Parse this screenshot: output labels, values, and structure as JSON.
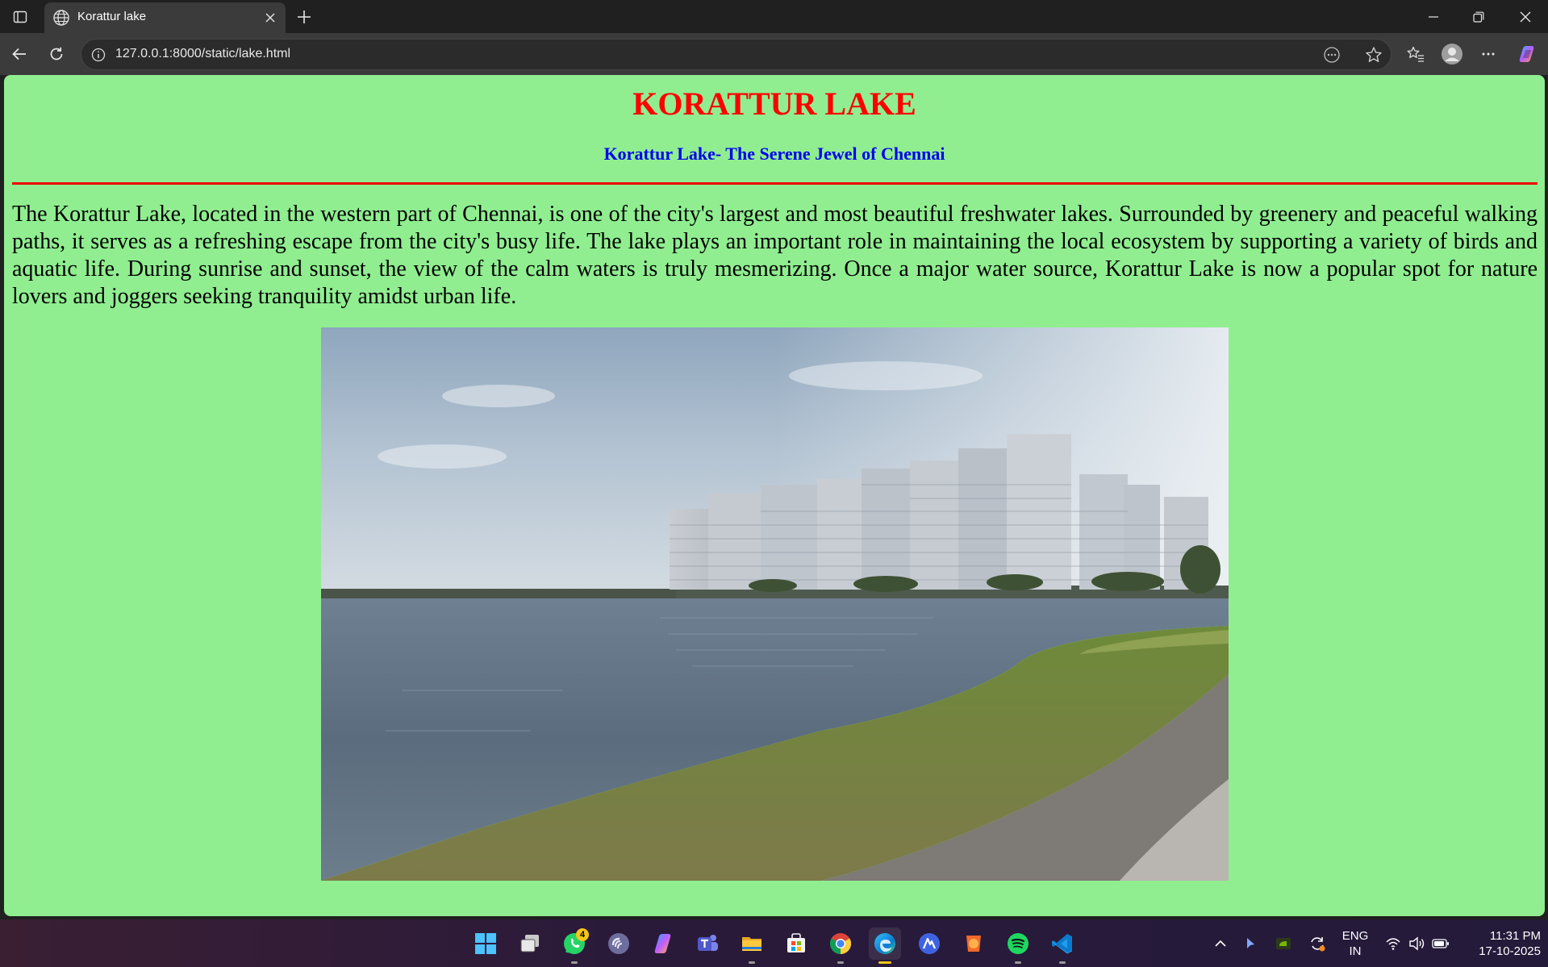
{
  "browser": {
    "tab_title": "Korattur lake",
    "url": "127.0.0.1:8000/static/lake.html"
  },
  "page": {
    "heading": "KORATTUR LAKE",
    "subheading": "Korattur Lake- The Serene Jewel of Chennai",
    "paragraph": "The Korattur Lake, located in the western part of Chennai, is one of the city's largest and most beautiful freshwater lakes. Surrounded by greenery and peaceful walking paths, it serves as a refreshing escape from the city's busy life. The lake plays an important role in maintaining the local ecosystem by supporting a variety of birds and aquatic life. During sunrise and sunset, the view of the calm waters is truly mesmerizing. Once a major water source, Korattur Lake is now a popular spot for nature lovers and joggers seeking tranquility amidst urban life.",
    "background_color": "#90ee90",
    "heading_color": "#ff0000",
    "subheading_color": "#0000ee"
  },
  "taskbar": {
    "apps": [
      "windows-start",
      "task-view",
      "whatsapp",
      "copilot-round",
      "copilot",
      "teams",
      "file-explorer",
      "microsoft-store",
      "chrome",
      "edge",
      "app-a",
      "app-orange",
      "spotify",
      "vscode"
    ],
    "whatsapp_badge": "4",
    "language_line1": "ENG",
    "language_line2": "IN",
    "time": "11:31 PM",
    "date": "17-10-2025"
  }
}
